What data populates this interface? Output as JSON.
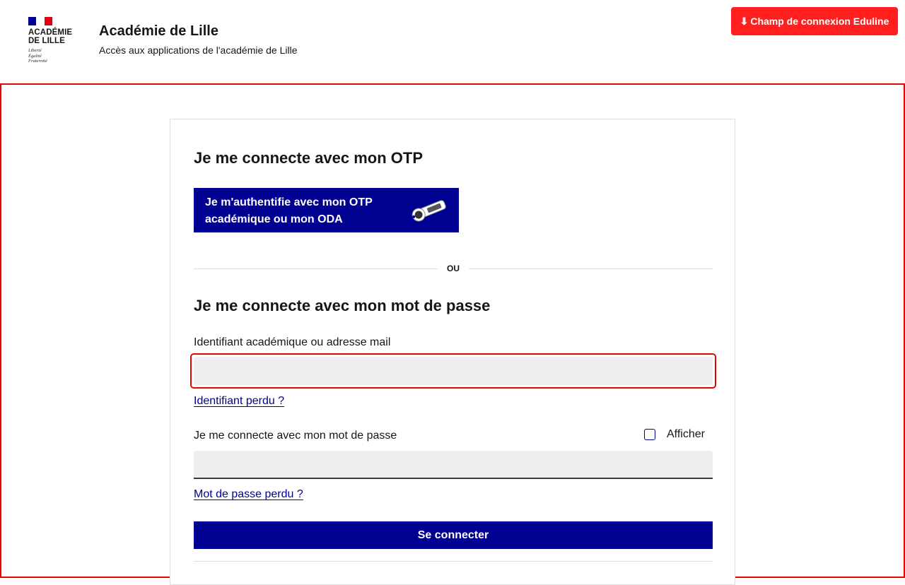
{
  "header": {
    "logo": {
      "name_line1": "ACADÉMIE",
      "name_line2": "DE LILLE",
      "motto_line1": "Liberté",
      "motto_line2": "Égalité",
      "motto_line3": "Fraternité"
    },
    "title": "Académie de Lille",
    "subtitle": "Accès aux applications de l'académie de Lille",
    "eduline_button": {
      "icon": "arrow-down-icon",
      "icon_glyph": "⬇",
      "label": "Champ de connexion Eduline",
      "color": "#ff1f1f"
    }
  },
  "card": {
    "otp_heading": "Je me connecte avec mon OTP",
    "otp_button": {
      "label": "Je m'authentifie avec mon OTP académique ou mon ODA",
      "icon": "otp-key-icon",
      "color": "#000091"
    },
    "separator": "OU",
    "password_heading": "Je me connecte avec mon mot de passe",
    "username": {
      "label": "Identifiant académique ou adresse mail",
      "value": "",
      "placeholder": "",
      "focused": true
    },
    "lost_username_link": "Identifiant perdu ?",
    "password": {
      "label": "Je me connecte avec mon mot de passe",
      "value": "",
      "placeholder": "",
      "show_label": "Afficher",
      "show_checked": false
    },
    "lost_password_link": "Mot de passe perdu ?",
    "submit_label": "Se connecter"
  },
  "colors": {
    "primary_blue": "#000091",
    "focus_red": "#e10600",
    "field_bg": "#eeeeee"
  }
}
